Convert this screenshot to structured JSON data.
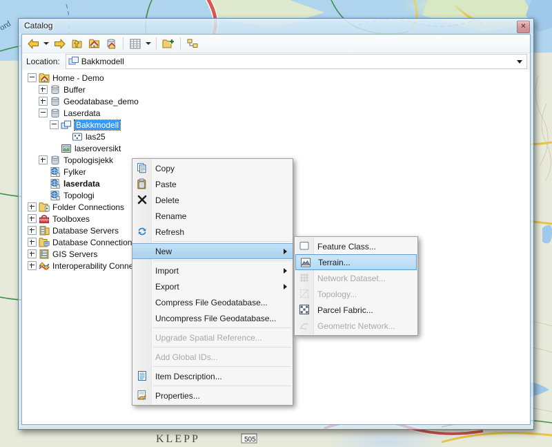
{
  "window": {
    "title": "Catalog",
    "close_label": "✕",
    "close_icon": "close-icon"
  },
  "toolbar": {
    "buttons": [
      {
        "name": "back-button",
        "icon": "arrow-left-icon",
        "label": "Back"
      },
      {
        "name": "back-dropdown",
        "icon": "chevron-down-icon",
        "label": ""
      },
      {
        "name": "forward-button",
        "icon": "arrow-right-icon",
        "label": "Forward"
      },
      {
        "name": "up-one-level-button",
        "icon": "arrow-up-folder-icon",
        "label": "Up One Level"
      },
      {
        "name": "home-button",
        "icon": "home-folder-icon",
        "label": "Home"
      },
      {
        "name": "default-geodatabase-button",
        "icon": "home-database-icon",
        "label": "Default Geodatabase"
      },
      {
        "name": "view-button",
        "icon": "grid-view-icon",
        "label": "View"
      },
      {
        "name": "view-dropdown",
        "icon": "chevron-down-icon",
        "label": ""
      },
      {
        "name": "connect-folder-button",
        "icon": "connect-folder-icon",
        "label": "Connect To Folder"
      },
      {
        "name": "toggle-contents-panel-button",
        "icon": "tree-panel-icon",
        "label": "Toggle Contents Panel"
      }
    ]
  },
  "location": {
    "label": "Location:",
    "value": "Bakkmodell",
    "icon": "feature-dataset-icon",
    "dropdown_icon": "chevron-down-icon"
  },
  "tree": {
    "items": [
      {
        "label": "Home - Demo",
        "indent": 0,
        "expander": "minus",
        "icon": "home-folder-icon",
        "selected": false,
        "bold": false
      },
      {
        "label": "Buffer",
        "indent": 1,
        "expander": "plus",
        "icon": "geodatabase-icon",
        "selected": false,
        "bold": false
      },
      {
        "label": "Geodatabase_demo",
        "indent": 1,
        "expander": "plus",
        "icon": "geodatabase-icon",
        "selected": false,
        "bold": false
      },
      {
        "label": "Laserdata",
        "indent": 1,
        "expander": "minus",
        "icon": "geodatabase-icon",
        "selected": false,
        "bold": false
      },
      {
        "label": "Bakkmodell",
        "indent": 2,
        "expander": "minus",
        "icon": "feature-dataset-icon",
        "selected": true,
        "bold": false
      },
      {
        "label": "las25",
        "indent": 3,
        "expander": "none",
        "icon": "multipoint-icon",
        "selected": false,
        "bold": false
      },
      {
        "label": "laseroversikt",
        "indent": 2,
        "expander": "none",
        "icon": "raster-icon",
        "selected": false,
        "bold": false
      },
      {
        "label": "Topologisjekk",
        "indent": 1,
        "expander": "plus",
        "icon": "geodatabase-icon",
        "selected": false,
        "bold": false
      },
      {
        "label": "Fylker",
        "indent": 1,
        "expander": "none",
        "icon": "layer-file-icon",
        "selected": false,
        "bold": false
      },
      {
        "label": "laserdata",
        "indent": 1,
        "expander": "none",
        "icon": "layer-file-icon",
        "selected": false,
        "bold": true
      },
      {
        "label": "Topologi",
        "indent": 1,
        "expander": "none",
        "icon": "layer-file-icon",
        "selected": false,
        "bold": false
      },
      {
        "label": "Folder Connections",
        "indent": 0,
        "expander": "plus",
        "icon": "folder-connections-icon",
        "selected": false,
        "bold": false
      },
      {
        "label": "Toolboxes",
        "indent": 0,
        "expander": "plus",
        "icon": "toolboxes-icon",
        "selected": false,
        "bold": false
      },
      {
        "label": "Database Servers",
        "indent": 0,
        "expander": "plus",
        "icon": "database-servers-icon",
        "selected": false,
        "bold": false
      },
      {
        "label": "Database Connections",
        "indent": 0,
        "expander": "plus",
        "icon": "database-connections-icon",
        "selected": false,
        "bold": false
      },
      {
        "label": "GIS Servers",
        "indent": 0,
        "expander": "plus",
        "icon": "gis-servers-icon",
        "selected": false,
        "bold": false
      },
      {
        "label": "Interoperability Connections",
        "indent": 0,
        "expander": "plus",
        "icon": "interoperability-icon",
        "selected": false,
        "bold": false
      }
    ]
  },
  "context_menu": {
    "items": [
      {
        "label": "Copy",
        "icon": "copy-icon",
        "type": "item",
        "disabled": false,
        "submenu": false,
        "highlight": false
      },
      {
        "label": "Paste",
        "icon": "paste-icon",
        "type": "item",
        "disabled": false,
        "submenu": false,
        "highlight": false
      },
      {
        "label": "Delete",
        "icon": "delete-x-icon",
        "type": "item",
        "disabled": false,
        "submenu": false,
        "highlight": false
      },
      {
        "label": "Rename",
        "icon": "",
        "type": "item",
        "disabled": false,
        "submenu": false,
        "highlight": false
      },
      {
        "label": "Refresh",
        "icon": "refresh-icon",
        "type": "item",
        "disabled": false,
        "submenu": false,
        "highlight": false
      },
      {
        "label": "",
        "icon": "",
        "type": "separator",
        "disabled": false,
        "submenu": false,
        "highlight": false
      },
      {
        "label": "New",
        "icon": "",
        "type": "item",
        "disabled": false,
        "submenu": true,
        "highlight": true
      },
      {
        "label": "",
        "icon": "",
        "type": "separator",
        "disabled": false,
        "submenu": false,
        "highlight": false
      },
      {
        "label": "Import",
        "icon": "",
        "type": "item",
        "disabled": false,
        "submenu": true,
        "highlight": false
      },
      {
        "label": "Export",
        "icon": "",
        "type": "item",
        "disabled": false,
        "submenu": true,
        "highlight": false
      },
      {
        "label": "Compress File Geodatabase...",
        "icon": "",
        "type": "item",
        "disabled": false,
        "submenu": false,
        "highlight": false
      },
      {
        "label": "Uncompress File Geodatabase...",
        "icon": "",
        "type": "item",
        "disabled": false,
        "submenu": false,
        "highlight": false
      },
      {
        "label": "",
        "icon": "",
        "type": "separator",
        "disabled": false,
        "submenu": false,
        "highlight": false
      },
      {
        "label": "Upgrade Spatial Reference...",
        "icon": "",
        "type": "item",
        "disabled": true,
        "submenu": false,
        "highlight": false
      },
      {
        "label": "",
        "icon": "",
        "type": "separator",
        "disabled": false,
        "submenu": false,
        "highlight": false
      },
      {
        "label": "Add Global IDs...",
        "icon": "",
        "type": "item",
        "disabled": true,
        "submenu": false,
        "highlight": false
      },
      {
        "label": "",
        "icon": "",
        "type": "separator",
        "disabled": false,
        "submenu": false,
        "highlight": false
      },
      {
        "label": "Item Description...",
        "icon": "item-description-icon",
        "type": "item",
        "disabled": false,
        "submenu": false,
        "highlight": false
      },
      {
        "label": "",
        "icon": "",
        "type": "separator",
        "disabled": false,
        "submenu": false,
        "highlight": false
      },
      {
        "label": "Properties...",
        "icon": "properties-icon",
        "type": "item",
        "disabled": false,
        "submenu": false,
        "highlight": false
      }
    ]
  },
  "submenu": {
    "items": [
      {
        "label": "Feature Class...",
        "icon": "feature-class-icon",
        "disabled": false,
        "highlight": false
      },
      {
        "label": "Terrain...",
        "icon": "terrain-icon",
        "disabled": false,
        "highlight": true
      },
      {
        "label": "Network Dataset...",
        "icon": "network-dataset-icon",
        "disabled": true,
        "highlight": false
      },
      {
        "label": "Topology...",
        "icon": "topology-icon",
        "disabled": true,
        "highlight": false
      },
      {
        "label": "Parcel Fabric...",
        "icon": "parcel-fabric-icon",
        "disabled": false,
        "highlight": false
      },
      {
        "label": "Geometric Network...",
        "icon": "geometric-network-icon",
        "disabled": true,
        "highlight": false
      }
    ]
  },
  "background_map": {
    "labels": [
      "KLEPP",
      "505"
    ],
    "colors": {
      "water": "#aed4ee",
      "land": "#e6ead7",
      "road_major": "#d8584f",
      "road_minor": "#e9c44a",
      "forest": "#3f8f47"
    }
  }
}
